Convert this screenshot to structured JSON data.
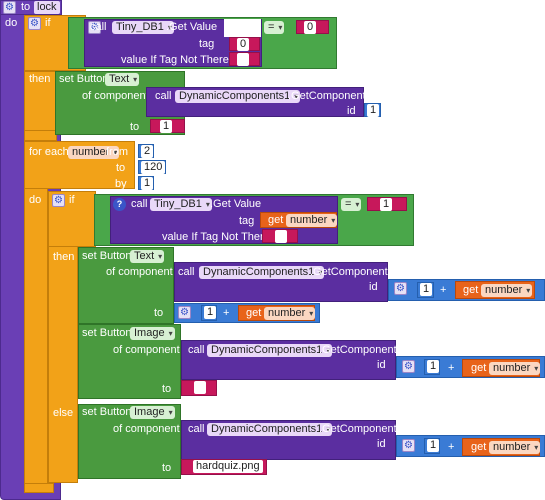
{
  "proc": {
    "to": "to",
    "name": "lock",
    "do": "do"
  },
  "if1": {
    "if": "if",
    "then": "then",
    "call": "call",
    "component": "Tiny_DB1",
    "method": ".Get Value",
    "tag_label": "tag",
    "tag_value": "0",
    "notthere_label": "value If Tag Not There",
    "notthere_value": "",
    "op": "=",
    "compare_value": "0",
    "set": "set Button.",
    "prop": "Text",
    "ofcomp": "of component",
    "dyn": "DynamicComponents1",
    "getcomp": ".GetComponent",
    "id": "id",
    "id_value": "1",
    "to": "to",
    "to_value": "1"
  },
  "loop": {
    "for": "for each",
    "var": "number",
    "from": "from",
    "from_value": "2",
    "to": "to",
    "to_value": "120",
    "by": "by",
    "by_value": "1",
    "do": "do"
  },
  "if2": {
    "if": "if",
    "then": "then",
    "else": "else",
    "call": "call",
    "component": "Tiny_DB1",
    "method": ".Get Value",
    "tag_label": "tag",
    "get": "get",
    "var": "number",
    "notthere_label": "value If Tag Not There",
    "notthere_value": "",
    "op": "=",
    "compare_value": "1",
    "s1": {
      "set": "set Button.",
      "prop": "Text",
      "ofcomp": "of component",
      "call": "call",
      "dyn": "DynamicComponents1",
      "getcomp": ".GetComponent",
      "id": "id",
      "one": "1",
      "plus": "+",
      "get": "get",
      "var": "number",
      "to": "to",
      "to_one": "1",
      "to_plus": "+",
      "to_get": "get",
      "to_var": "number"
    },
    "s2": {
      "set": "set Button.",
      "prop": "Image",
      "ofcomp": "of component",
      "call": "call",
      "dyn": "DynamicComponents1",
      "getcomp": ".GetComponent",
      "id": "id",
      "one": "1",
      "plus": "+",
      "get": "get",
      "var": "number",
      "to": "to",
      "to_value": ""
    },
    "s3": {
      "set": "set Button.",
      "prop": "Image",
      "ofcomp": "of component",
      "call": "call",
      "dyn": "DynamicComponents1",
      "getcomp": ".GetComponent",
      "id": "id",
      "one": "1",
      "plus": "+",
      "get": "get",
      "var": "number",
      "to": "to",
      "to_value": "hardquiz.png"
    }
  }
}
